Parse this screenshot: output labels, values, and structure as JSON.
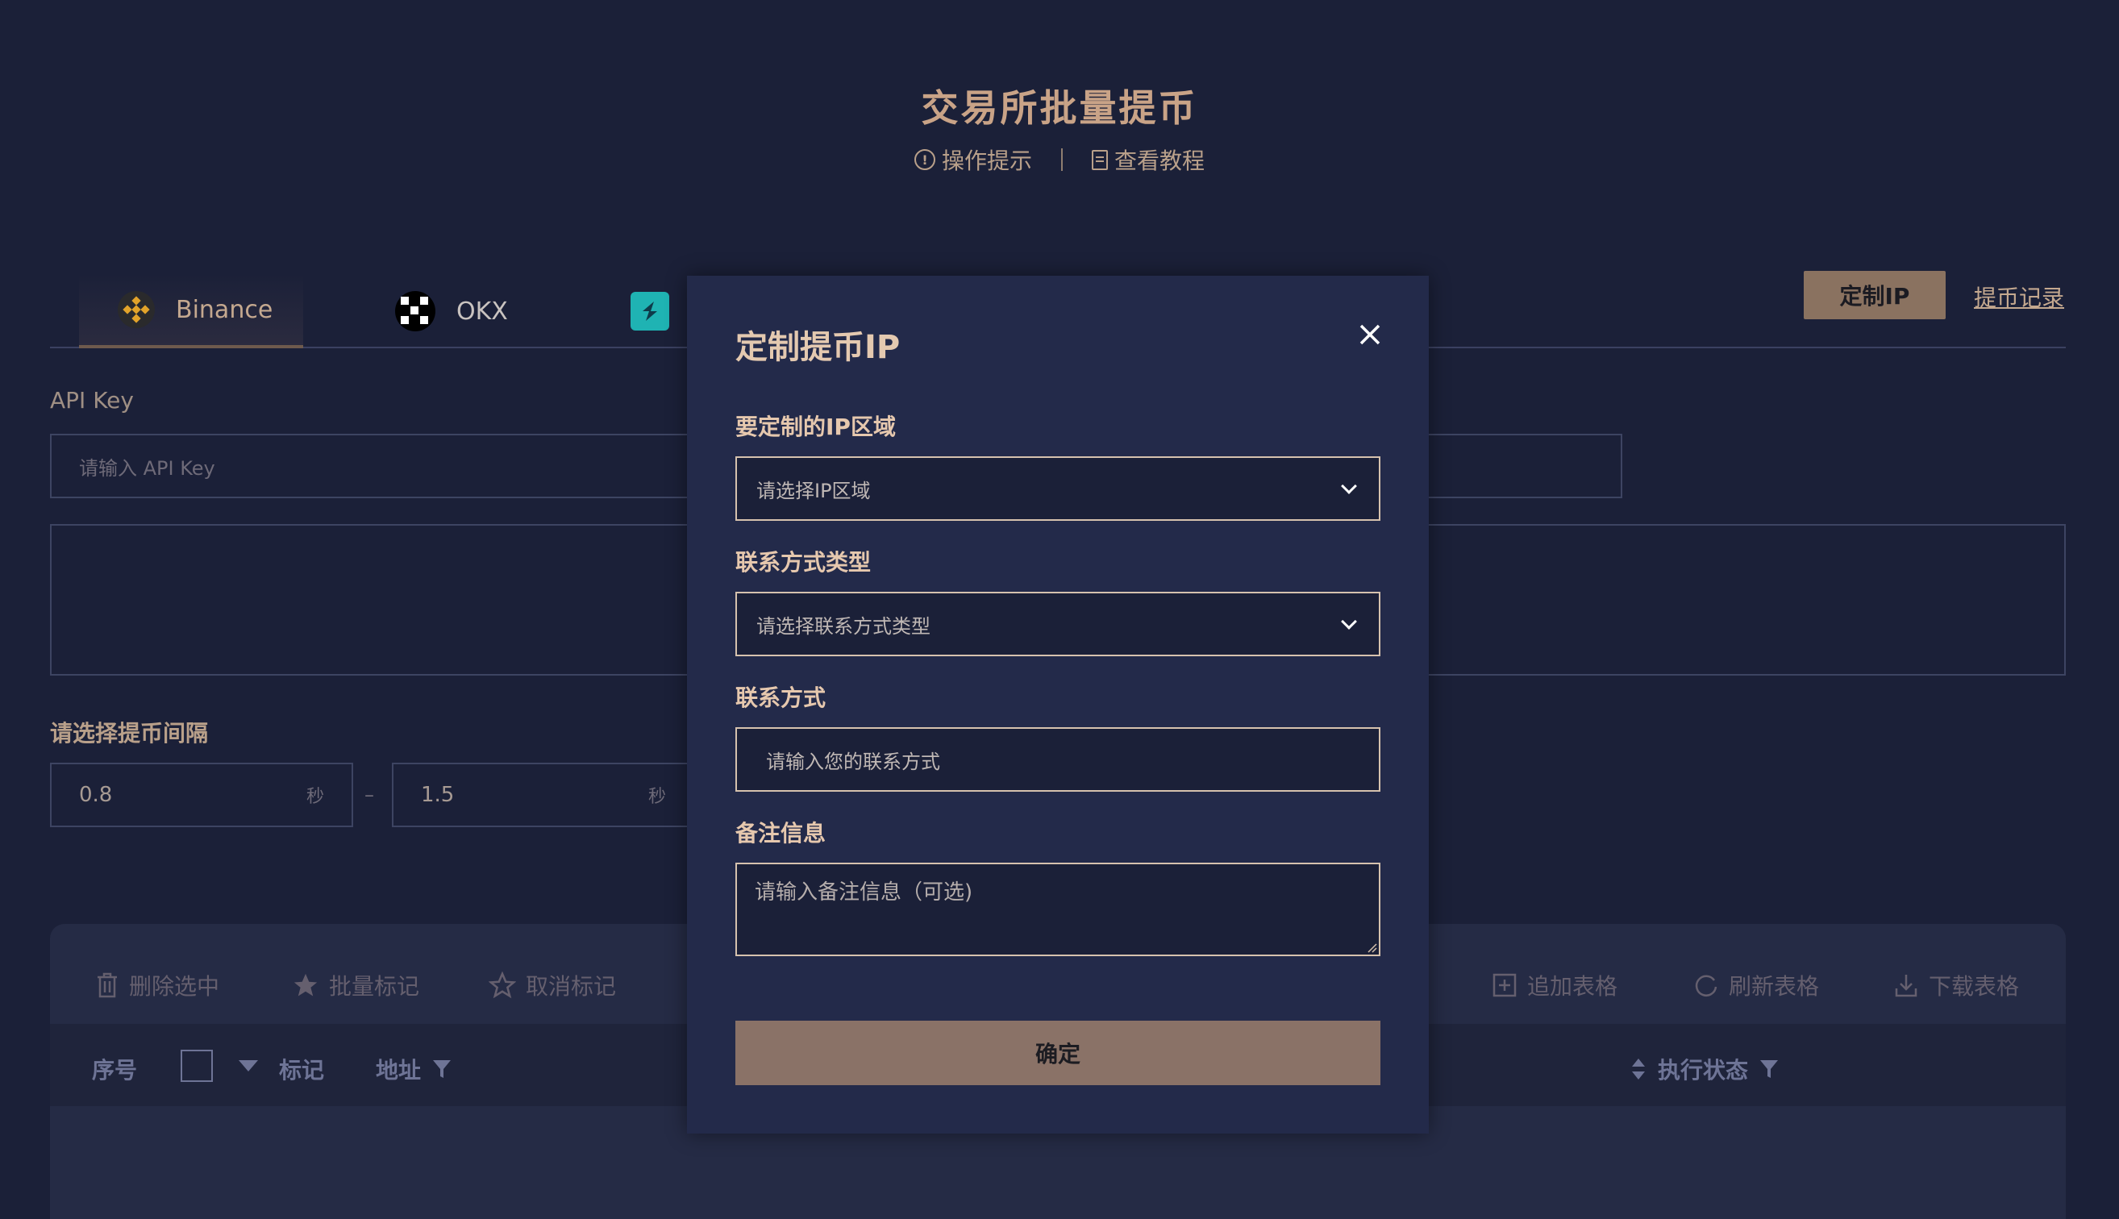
{
  "header": {
    "title": "交易所批量提币",
    "tips_label": "操作提示",
    "tutorial_label": "查看教程"
  },
  "tabs": [
    {
      "label": "Binance",
      "icon": "binance-icon",
      "active": true
    },
    {
      "label": "OKX",
      "icon": "okx-icon"
    },
    {
      "label": "",
      "icon": "exchange-logo-icon"
    }
  ],
  "top_actions": {
    "custom_ip_label": "定制IP",
    "records_label": "提币记录"
  },
  "form": {
    "api_key_label": "API Key",
    "api_key_placeholder": "请输入 API Key",
    "interval_label": "请选择提币间隔",
    "interval_min": "0.8",
    "interval_max": "1.5",
    "interval_unit": "秒",
    "interval_separator": "–"
  },
  "toolbar": {
    "delete_selected": "删除选中",
    "batch_mark": "批量标记",
    "unmark": "取消标记",
    "append_table": "追加表格",
    "refresh_table": "刷新表格",
    "download_table": "下载表格"
  },
  "table": {
    "headers": {
      "index": "序号",
      "mark": "标记",
      "address": "地址",
      "status": "执行状态"
    }
  },
  "modal": {
    "title": "定制提币IP",
    "region_label": "要定制的IP区域",
    "region_placeholder": "请选择IP区域",
    "contact_type_label": "联系方式类型",
    "contact_type_placeholder": "请选择联系方式类型",
    "contact_label": "联系方式",
    "contact_placeholder": "请输入您的联系方式",
    "remark_label": "备注信息",
    "remark_placeholder": "请输入备注信息（可选)",
    "confirm_label": "确定"
  },
  "colors": {
    "background": "#1b2038",
    "modal": "#232a4a",
    "accent": "#8a7260",
    "label": "#e6c8ae"
  }
}
